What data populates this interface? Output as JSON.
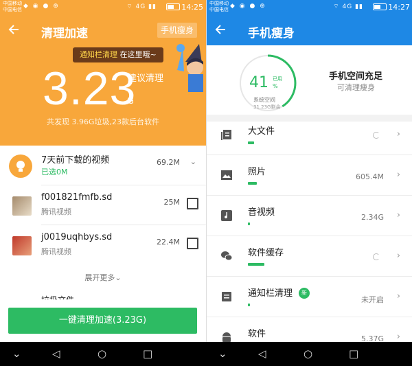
{
  "status_left": {
    "carrier1": "中国移动",
    "carrier2": "中国电信",
    "network": "4G",
    "time": "14:25"
  },
  "status_right": {
    "carrier1": "中国移动",
    "carrier2": "中国电信",
    "network": "4G",
    "time": "14:27"
  },
  "left": {
    "title": "清理加速",
    "slim_button": "手机瘦身",
    "tooltip_highlight": "通知栏清理",
    "tooltip_rest": " 在这里哦~",
    "big_number": "3.23",
    "suggest_label": "建议清理",
    "unit": "G",
    "found_text": "共发现 3.96G垃圾,23款后台软件",
    "rows": [
      {
        "name": "7天前下载的视频",
        "sub": "已选0M",
        "size": "69.2M"
      },
      {
        "name": "f001821fmfb.sd",
        "sub": "腾讯视频",
        "size": "25M"
      },
      {
        "name": "j0019uqhbys.sd",
        "sub": "腾讯视频",
        "size": "22.4M"
      }
    ],
    "expand_more": "展开更多",
    "partial_row": "垃圾文件",
    "clean_button": "一键清理加速(3.23G)"
  },
  "right": {
    "title": "手机瘦身",
    "gauge": {
      "value": "41",
      "used_label": "已用",
      "percent_sign": "%",
      "fill_fraction": 0.41,
      "system_label": "系统空间",
      "remaining": "31.23G剩余"
    },
    "status_title": "手机空间充足",
    "status_sub": "可清理瘦身",
    "items": [
      {
        "name": "大文件",
        "value": "",
        "loading": true,
        "bar": 0.04
      },
      {
        "name": "照片",
        "value": "605.4M",
        "loading": false,
        "bar": 0.06
      },
      {
        "name": "音视频",
        "value": "2.34G",
        "loading": false,
        "bar": 0.01
      },
      {
        "name": "软件缓存",
        "value": "",
        "loading": true,
        "bar": 0.11
      },
      {
        "name": "通知栏清理",
        "badge": "新",
        "value": "未开启",
        "loading": false,
        "bar": 0.01
      },
      {
        "name": "软件",
        "value": "5.37G",
        "loading": false,
        "bar": 0.35
      }
    ]
  },
  "colors": {
    "orange": "#f8a73b",
    "blue": "#1e88e5",
    "green": "#2dbb63"
  },
  "icons": [
    "back-arrow-icon",
    "bulb-icon",
    "file-icon",
    "image-icon",
    "music-icon",
    "wechat-icon",
    "notification-icon",
    "android-icon",
    "chevron-right-icon",
    "spinner-icon"
  ]
}
